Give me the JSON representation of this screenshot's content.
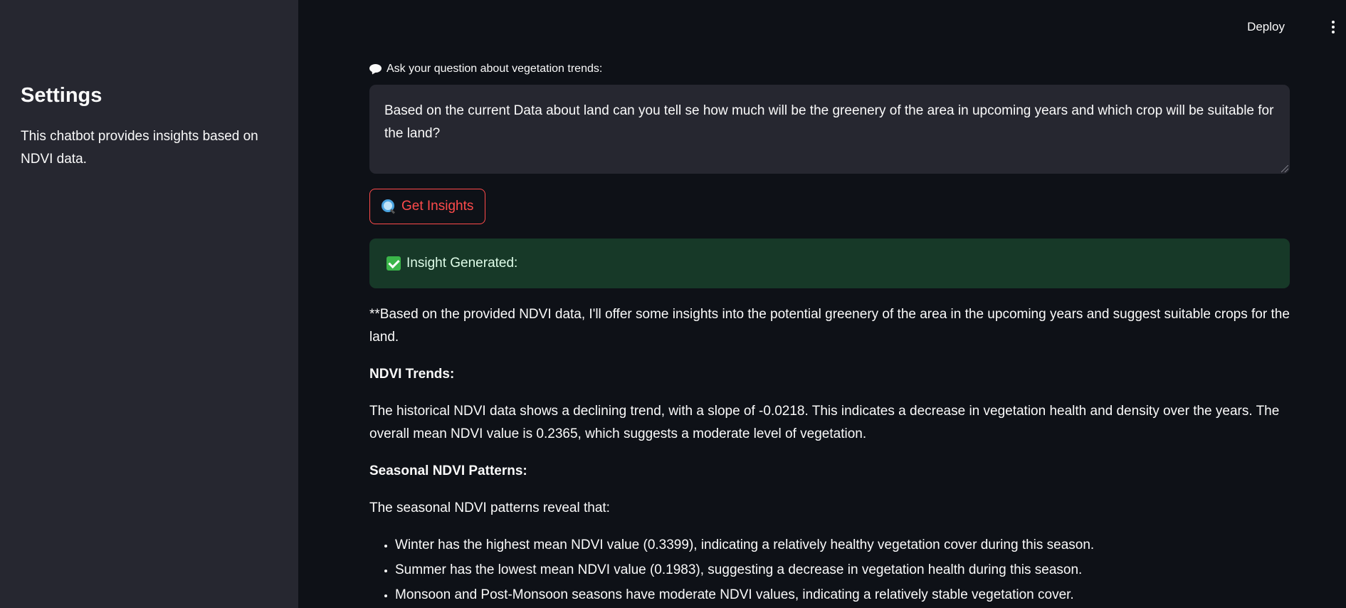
{
  "sidebar": {
    "title": "Settings",
    "description": "This chatbot provides insights based on NDVI data."
  },
  "header": {
    "deploy_label": "Deploy",
    "menu_icon": "kebab-menu-icon"
  },
  "query": {
    "label": "Ask your question about vegetation trends:",
    "label_icon": "speech-balloon-icon",
    "value": "Based on the current Data about land can you tell se how much will be the greenery of the area in upcoming years and which crop will be suitable for the land?"
  },
  "action": {
    "button_label": "Get Insights",
    "button_icon": "magnifier-icon",
    "accent_color": "#ff4b4b"
  },
  "status": {
    "label": "Insight Generated:",
    "icon": "check-mark-icon",
    "background": "#173928"
  },
  "response": {
    "intro": "**Based on the provided NDVI data, I'll offer some insights into the potential greenery of the area in the upcoming years and suggest suitable crops for the land.",
    "trends_heading": "NDVI Trends:",
    "trends_text": "The historical NDVI data shows a declining trend, with a slope of -0.0218. This indicates a decrease in vegetation health and density over the years. The overall mean NDVI value is 0.2365, which suggests a moderate level of vegetation.",
    "seasonal_heading": "Seasonal NDVI Patterns:",
    "seasonal_intro": "The seasonal NDVI patterns reveal that:",
    "bullets": [
      "Winter has the highest mean NDVI value (0.3399), indicating a relatively healthy vegetation cover during this season.",
      "Summer has the lowest mean NDVI value (0.1983), suggesting a decrease in vegetation health during this season.",
      "Monsoon and Post-Monsoon seasons have moderate NDVI values, indicating a relatively stable vegetation cover."
    ]
  }
}
